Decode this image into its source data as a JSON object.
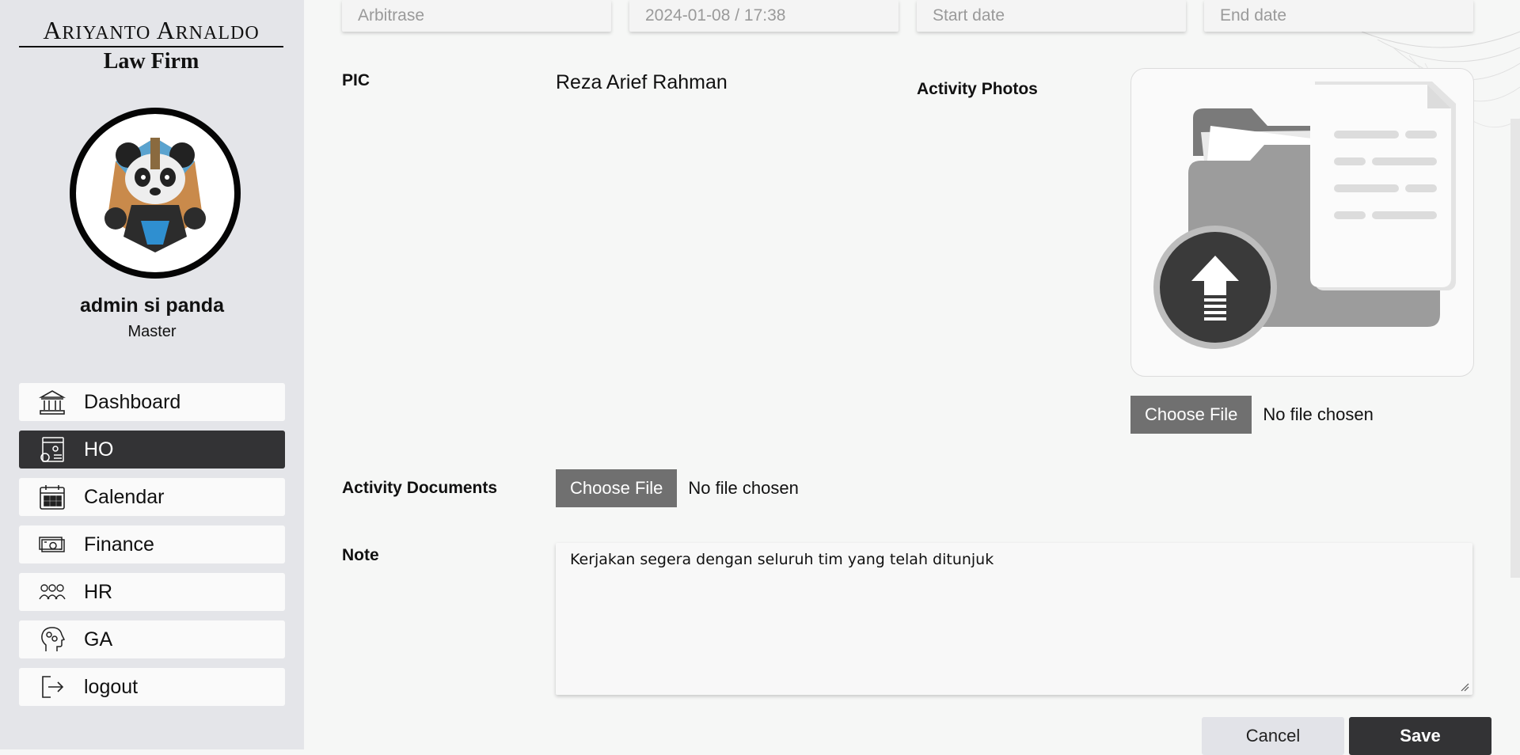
{
  "brand": {
    "line1_first_initial": "A",
    "line1_first_rest": "RIYANTO",
    "line1_second_initial": "A",
    "line1_second_rest": "RNALDO",
    "line2": "Law Firm"
  },
  "user": {
    "name": "admin si panda",
    "role": "Master"
  },
  "nav": [
    {
      "label": "Dashboard",
      "icon": "bank-icon",
      "active": false
    },
    {
      "label": "HO",
      "icon": "office-settings-icon",
      "active": true
    },
    {
      "label": "Calendar",
      "icon": "calendar-icon",
      "active": false
    },
    {
      "label": "Finance",
      "icon": "money-icon",
      "active": false
    },
    {
      "label": "HR",
      "icon": "team-icon",
      "active": false
    },
    {
      "label": "GA",
      "icon": "head-gears-icon",
      "active": false
    },
    {
      "label": "logout",
      "icon": "logout-icon",
      "active": false
    }
  ],
  "form": {
    "case_type": "Arbitrase",
    "created_at": "2024-01-08 / 17:38",
    "start_date_placeholder": "Start date",
    "end_date_placeholder": "End date",
    "pic_label": "PIC",
    "pic_value": "Reza Arief Rahman",
    "photos_label": "Activity Photos",
    "photos_button": "Choose File",
    "photos_status": "No file chosen",
    "documents_label": "Activity Documents",
    "documents_button": "Choose File",
    "documents_status": "No file chosen",
    "note_label": "Note",
    "note_value": "Kerjakan segera dengan seluruh tim yang telah ditunjuk"
  },
  "actions": {
    "cancel": "Cancel",
    "save": "Save"
  },
  "colors": {
    "sidebar_bg": "#e4e5e9",
    "active_nav": "#333335",
    "file_button": "#707070"
  }
}
